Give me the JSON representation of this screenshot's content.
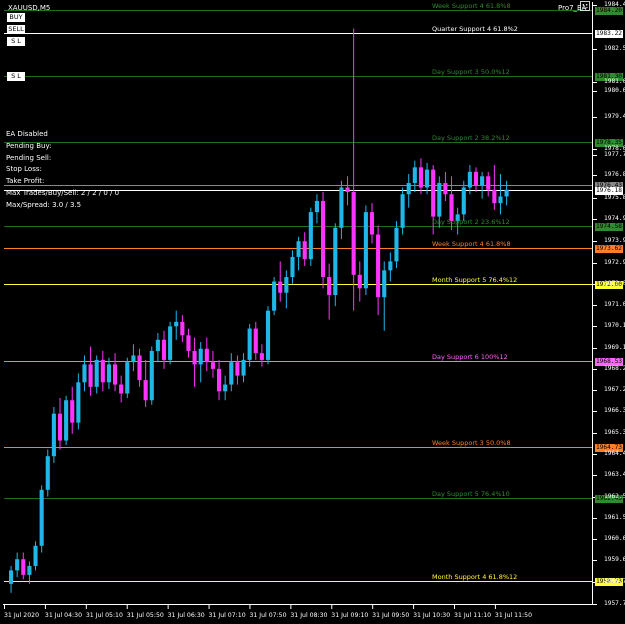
{
  "window": {
    "symbol_title": "XAUUSD,M5",
    "ea_name": "Pro7_EA"
  },
  "buttons": {
    "buy": "BUY",
    "sell": "SELL",
    "sl_top": "S L",
    "sl_bottom": "S L"
  },
  "info_panel": {
    "lines": [
      "EA Disabled",
      "Pending Buy:",
      "Pending Sell:",
      "Stop Loss:",
      "Take Profit:",
      "Max Trades/Buy/Sell: 2 / 2 / 0 / 0",
      "Max/Spread: 3.0 / 3.5"
    ]
  },
  "colors": {
    "bull": "#1fb6e8",
    "bear": "#ff33ff",
    "white_level": "#ffffff",
    "day_level": "#1f7a1f",
    "day_label": "#2e8b2e",
    "week_level": "#ff7f27",
    "month_level": "#ffff33",
    "pink_level": "#ff66ff"
  },
  "levels": [
    {
      "label": "Week Support 4 61.8%8",
      "price": 1984.22,
      "color": "#2e8b2e",
      "badge": "1984.20"
    },
    {
      "label": "Quarter Support 4 61.8%2",
      "price": 1983.22,
      "color": "#ffffff",
      "badge": "1983.22"
    },
    {
      "label": "Day Support 3 50.0%12",
      "price": 1981.3,
      "color": "#2e8b2e",
      "badge": "1981.30"
    },
    {
      "label": "Day Support 2 38.2%12",
      "price": 1978.35,
      "color": "#2e8b2e",
      "badge": "1978.35"
    },
    {
      "label": "Day Support 2 23.6%12",
      "price": 1974.58,
      "color": "#2e8b2e",
      "badge": "1974.58"
    },
    {
      "label": "Week Support 4 61.8%8",
      "price": 1973.62,
      "color": "#ff7f27",
      "badge": "1973.62"
    },
    {
      "label": "Month Support 5 76.4%12",
      "price": 1972.0,
      "color": "#ffff33",
      "badge": "1972.00"
    },
    {
      "label": "Day Support 6 100%12",
      "price": 1968.53,
      "color": "#ff66ff",
      "badge": "1968.53"
    },
    {
      "label": "Week Support 3 50.0%8",
      "price": 1964.73,
      "color": "#ff7f27",
      "badge": "1964.73"
    },
    {
      "label": "Day Support 5 76.4%10",
      "price": 1962.43,
      "color": "#2e8b2e",
      "badge": "1962.43"
    },
    {
      "label": "Month Support 4 61.8%12",
      "price": 1958.73,
      "color": "#ffff33",
      "badge": "1958.73"
    }
  ],
  "price_lines": [
    {
      "price": 1976.43,
      "badge": "1976.43",
      "color": "#888888"
    },
    {
      "price": 1976.18,
      "badge": "1976.18",
      "color": "#ffffff"
    }
  ],
  "chart_data": {
    "type": "candlestick",
    "symbol": "XAUUSD",
    "timeframe": "M5",
    "y_ticks": [
      1984.45,
      1982.5,
      1981.0,
      1980.6,
      1979.45,
      1978.0,
      1977.75,
      1976.85,
      1975.85,
      1974.9,
      1973.9,
      1972.95,
      1972.0,
      1971.05,
      1970.1,
      1969.15,
      1968.2,
      1967.25,
      1966.3,
      1965.35,
      1964.4,
      1963.45,
      1962.5,
      1961.55,
      1960.6,
      1959.65,
      1958.7,
      1957.7
    ],
    "y_tick_labels": [
      "1984.45",
      "1982.50",
      "1981.00",
      "1980.60",
      "1979.45",
      "1978.00",
      "1977.75",
      "1976.85",
      "1975.85",
      "1974.90",
      "1973.90",
      "1972.95",
      "1972.00",
      "1971.05",
      "1970.10",
      "1969.15",
      "1968.20",
      "1967.25",
      "1966.30",
      "1965.35",
      "1964.40",
      "1963.45",
      "1962.50",
      "1961.55",
      "1960.60",
      "1959.65",
      "1958.70",
      "1957.70"
    ],
    "x_labels": [
      "31 Jul 2020",
      "31 Jul 04:30",
      "31 Jul 05:10",
      "31 Jul 05:50",
      "31 Jul 06:30",
      "31 Jul 07:10",
      "31 Jul 07:50",
      "31 Jul 08:30",
      "31 Jul 09:10",
      "31 Jul 09:50",
      "31 Jul 10:30",
      "31 Jul 11:10",
      "31 Jul 11:50"
    ],
    "candles": [
      [
        1958.6,
        1959.4,
        1958.2,
        1959.2
      ],
      [
        1959.2,
        1960.0,
        1958.9,
        1959.7
      ],
      [
        1959.7,
        1960.0,
        1958.8,
        1959.0
      ],
      [
        1959.0,
        1959.6,
        1958.6,
        1959.4
      ],
      [
        1959.4,
        1960.5,
        1959.2,
        1960.3
      ],
      [
        1960.3,
        1963.0,
        1960.0,
        1962.8
      ],
      [
        1962.8,
        1964.6,
        1962.5,
        1964.3
      ],
      [
        1964.3,
        1966.5,
        1964.0,
        1966.2
      ],
      [
        1966.2,
        1966.9,
        1964.6,
        1965.0
      ],
      [
        1965.0,
        1967.0,
        1964.8,
        1966.8
      ],
      [
        1966.8,
        1967.4,
        1965.3,
        1965.8
      ],
      [
        1965.8,
        1968.0,
        1965.5,
        1967.6
      ],
      [
        1967.6,
        1968.8,
        1967.2,
        1968.4
      ],
      [
        1968.4,
        1969.2,
        1967.0,
        1967.4
      ],
      [
        1967.4,
        1968.8,
        1967.1,
        1968.6
      ],
      [
        1968.6,
        1969.0,
        1967.2,
        1967.6
      ],
      [
        1967.6,
        1968.7,
        1967.3,
        1968.4
      ],
      [
        1968.4,
        1968.9,
        1967.2,
        1967.5
      ],
      [
        1967.5,
        1967.9,
        1966.7,
        1967.1
      ],
      [
        1967.1,
        1968.7,
        1966.9,
        1968.5
      ],
      [
        1968.5,
        1969.3,
        1968.1,
        1968.8
      ],
      [
        1968.8,
        1969.1,
        1967.4,
        1967.7
      ],
      [
        1967.7,
        1968.6,
        1966.5,
        1966.8
      ],
      [
        1966.8,
        1969.2,
        1966.6,
        1969.0
      ],
      [
        1969.0,
        1969.8,
        1968.5,
        1969.5
      ],
      [
        1969.5,
        1969.9,
        1968.2,
        1968.6
      ],
      [
        1968.6,
        1970.3,
        1968.4,
        1970.1
      ],
      [
        1970.1,
        1970.8,
        1969.5,
        1970.3
      ],
      [
        1970.3,
        1970.6,
        1969.4,
        1969.7
      ],
      [
        1969.7,
        1970.0,
        1968.7,
        1969.0
      ],
      [
        1969.0,
        1969.6,
        1967.4,
        1968.4
      ],
      [
        1968.4,
        1969.4,
        1967.6,
        1969.1
      ],
      [
        1969.1,
        1969.6,
        1968.1,
        1968.5
      ],
      [
        1968.5,
        1969.0,
        1967.8,
        1968.2
      ],
      [
        1968.2,
        1968.6,
        1966.8,
        1967.2
      ],
      [
        1967.2,
        1967.9,
        1966.8,
        1967.5
      ],
      [
        1967.5,
        1968.9,
        1967.2,
        1968.5
      ],
      [
        1968.5,
        1968.8,
        1967.5,
        1967.9
      ],
      [
        1967.9,
        1968.9,
        1967.6,
        1968.6
      ],
      [
        1968.6,
        1970.2,
        1968.3,
        1970.0
      ],
      [
        1970.0,
        1970.3,
        1968.6,
        1968.9
      ],
      [
        1968.9,
        1969.3,
        1968.3,
        1968.6
      ],
      [
        1968.6,
        1971.0,
        1968.4,
        1970.8
      ],
      [
        1970.8,
        1972.3,
        1970.6,
        1972.1
      ],
      [
        1972.1,
        1973.0,
        1971.2,
        1971.6
      ],
      [
        1971.6,
        1972.6,
        1970.9,
        1972.3
      ],
      [
        1972.3,
        1973.5,
        1972.0,
        1973.2
      ],
      [
        1973.2,
        1974.1,
        1972.6,
        1973.9
      ],
      [
        1973.9,
        1974.3,
        1972.8,
        1973.1
      ],
      [
        1973.1,
        1975.4,
        1972.8,
        1975.2
      ],
      [
        1975.2,
        1976.0,
        1974.7,
        1975.7
      ],
      [
        1975.7,
        1976.1,
        1971.8,
        1972.3
      ],
      [
        1972.3,
        1972.9,
        1970.4,
        1971.5
      ],
      [
        1971.5,
        1974.7,
        1971.0,
        1974.5
      ],
      [
        1974.5,
        1976.6,
        1974.0,
        1976.3
      ],
      [
        1976.3,
        1976.8,
        1975.5,
        1976.1
      ],
      [
        1976.1,
        1983.4,
        1970.8,
        1972.4
      ],
      [
        1972.4,
        1973.0,
        1971.2,
        1971.8
      ],
      [
        1971.8,
        1975.5,
        1971.5,
        1975.2
      ],
      [
        1975.2,
        1975.6,
        1973.8,
        1974.2
      ],
      [
        1974.2,
        1974.6,
        1970.6,
        1971.4
      ],
      [
        1971.4,
        1973.0,
        1969.9,
        1972.6
      ],
      [
        1972.6,
        1973.4,
        1972.1,
        1973.0
      ],
      [
        1973.0,
        1974.8,
        1972.7,
        1974.5
      ],
      [
        1974.5,
        1976.3,
        1974.2,
        1976.0
      ],
      [
        1976.0,
        1976.9,
        1975.4,
        1976.5
      ],
      [
        1976.5,
        1977.5,
        1976.1,
        1977.2
      ],
      [
        1977.2,
        1977.6,
        1976.0,
        1976.3
      ],
      [
        1976.3,
        1977.4,
        1976.0,
        1977.1
      ],
      [
        1977.1,
        1977.3,
        1974.2,
        1975.0
      ],
      [
        1975.0,
        1976.8,
        1974.5,
        1976.5
      ],
      [
        1976.5,
        1977.0,
        1975.7,
        1976.0
      ],
      [
        1976.0,
        1976.8,
        1974.4,
        1974.8
      ],
      [
        1974.8,
        1975.4,
        1974.2,
        1975.1
      ],
      [
        1975.1,
        1976.6,
        1974.8,
        1976.3
      ],
      [
        1976.3,
        1977.3,
        1976.0,
        1977.0
      ],
      [
        1977.0,
        1977.2,
        1976.1,
        1976.4
      ],
      [
        1976.4,
        1977.0,
        1975.8,
        1976.8
      ],
      [
        1976.8,
        1977.0,
        1975.9,
        1976.2
      ],
      [
        1976.2,
        1977.3,
        1975.3,
        1975.6
      ],
      [
        1975.6,
        1976.9,
        1975.1,
        1975.9
      ],
      [
        1975.9,
        1976.6,
        1975.5,
        1976.2
      ]
    ],
    "xlim_candles": 85
  }
}
